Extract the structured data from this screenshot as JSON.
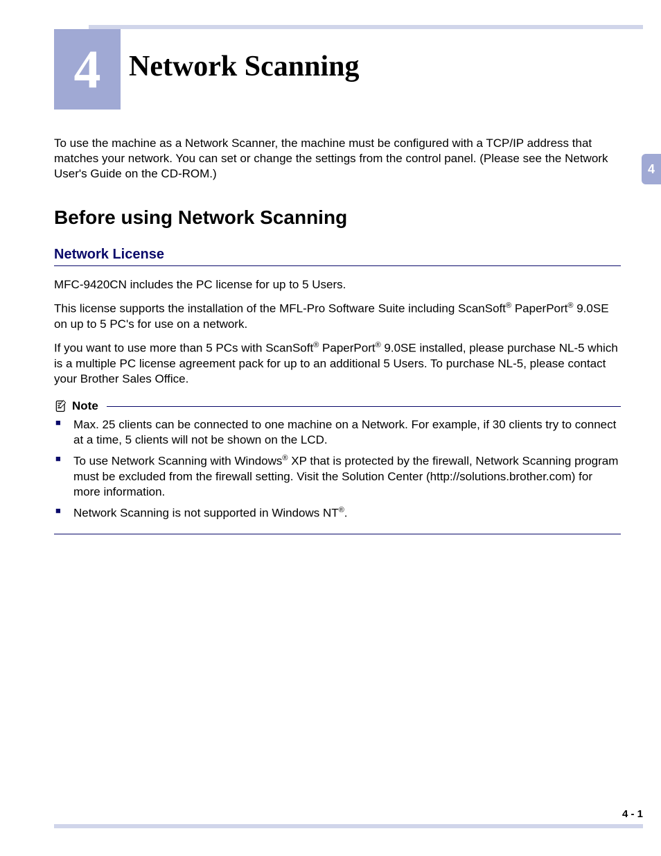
{
  "chapter": {
    "number": "4",
    "title": "Network Scanning"
  },
  "sideTab": "4",
  "intro": "To use the machine as a Network Scanner, the machine must be configured with a TCP/IP address that matches your network. You can set or change the settings from the control panel. (Please see the Network User's Guide on the CD-ROM.)",
  "section1": {
    "title": "Before using Network Scanning",
    "sub1": {
      "title": "Network License",
      "p1": "MFC-9420CN includes the PC license for up to 5 Users.",
      "p2_a": "This license supports the installation of the MFL-Pro Software Suite including ScanSoft",
      "p2_b": " PaperPort",
      "p2_c": " 9.0SE on up to 5 PC's for use on a network.",
      "p3_a": "If you want to use more than 5 PCs with ScanSoft",
      "p3_b": " PaperPort",
      "p3_c": " 9.0SE installed, please purchase NL-5 which is a multiple PC license agreement pack for up to an additional 5 Users. To purchase NL-5, please contact your Brother Sales Office."
    }
  },
  "note": {
    "label": "Note",
    "items": {
      "i1": "Max. 25 clients can be connected to one machine on a Network. For example, if 30 clients try to connect at a time, 5 clients will not be shown on the LCD.",
      "i2_a": "To use Network Scanning with Windows",
      "i2_b": " XP that is protected by the firewall, Network Scanning program must be excluded from the firewall setting. Visit the Solution Center (http://solutions.brother.com) for more information.",
      "i3_a": "Network Scanning is not supported in Windows NT",
      "i3_b": "."
    }
  },
  "reg": "®",
  "footer": "4 - 1"
}
